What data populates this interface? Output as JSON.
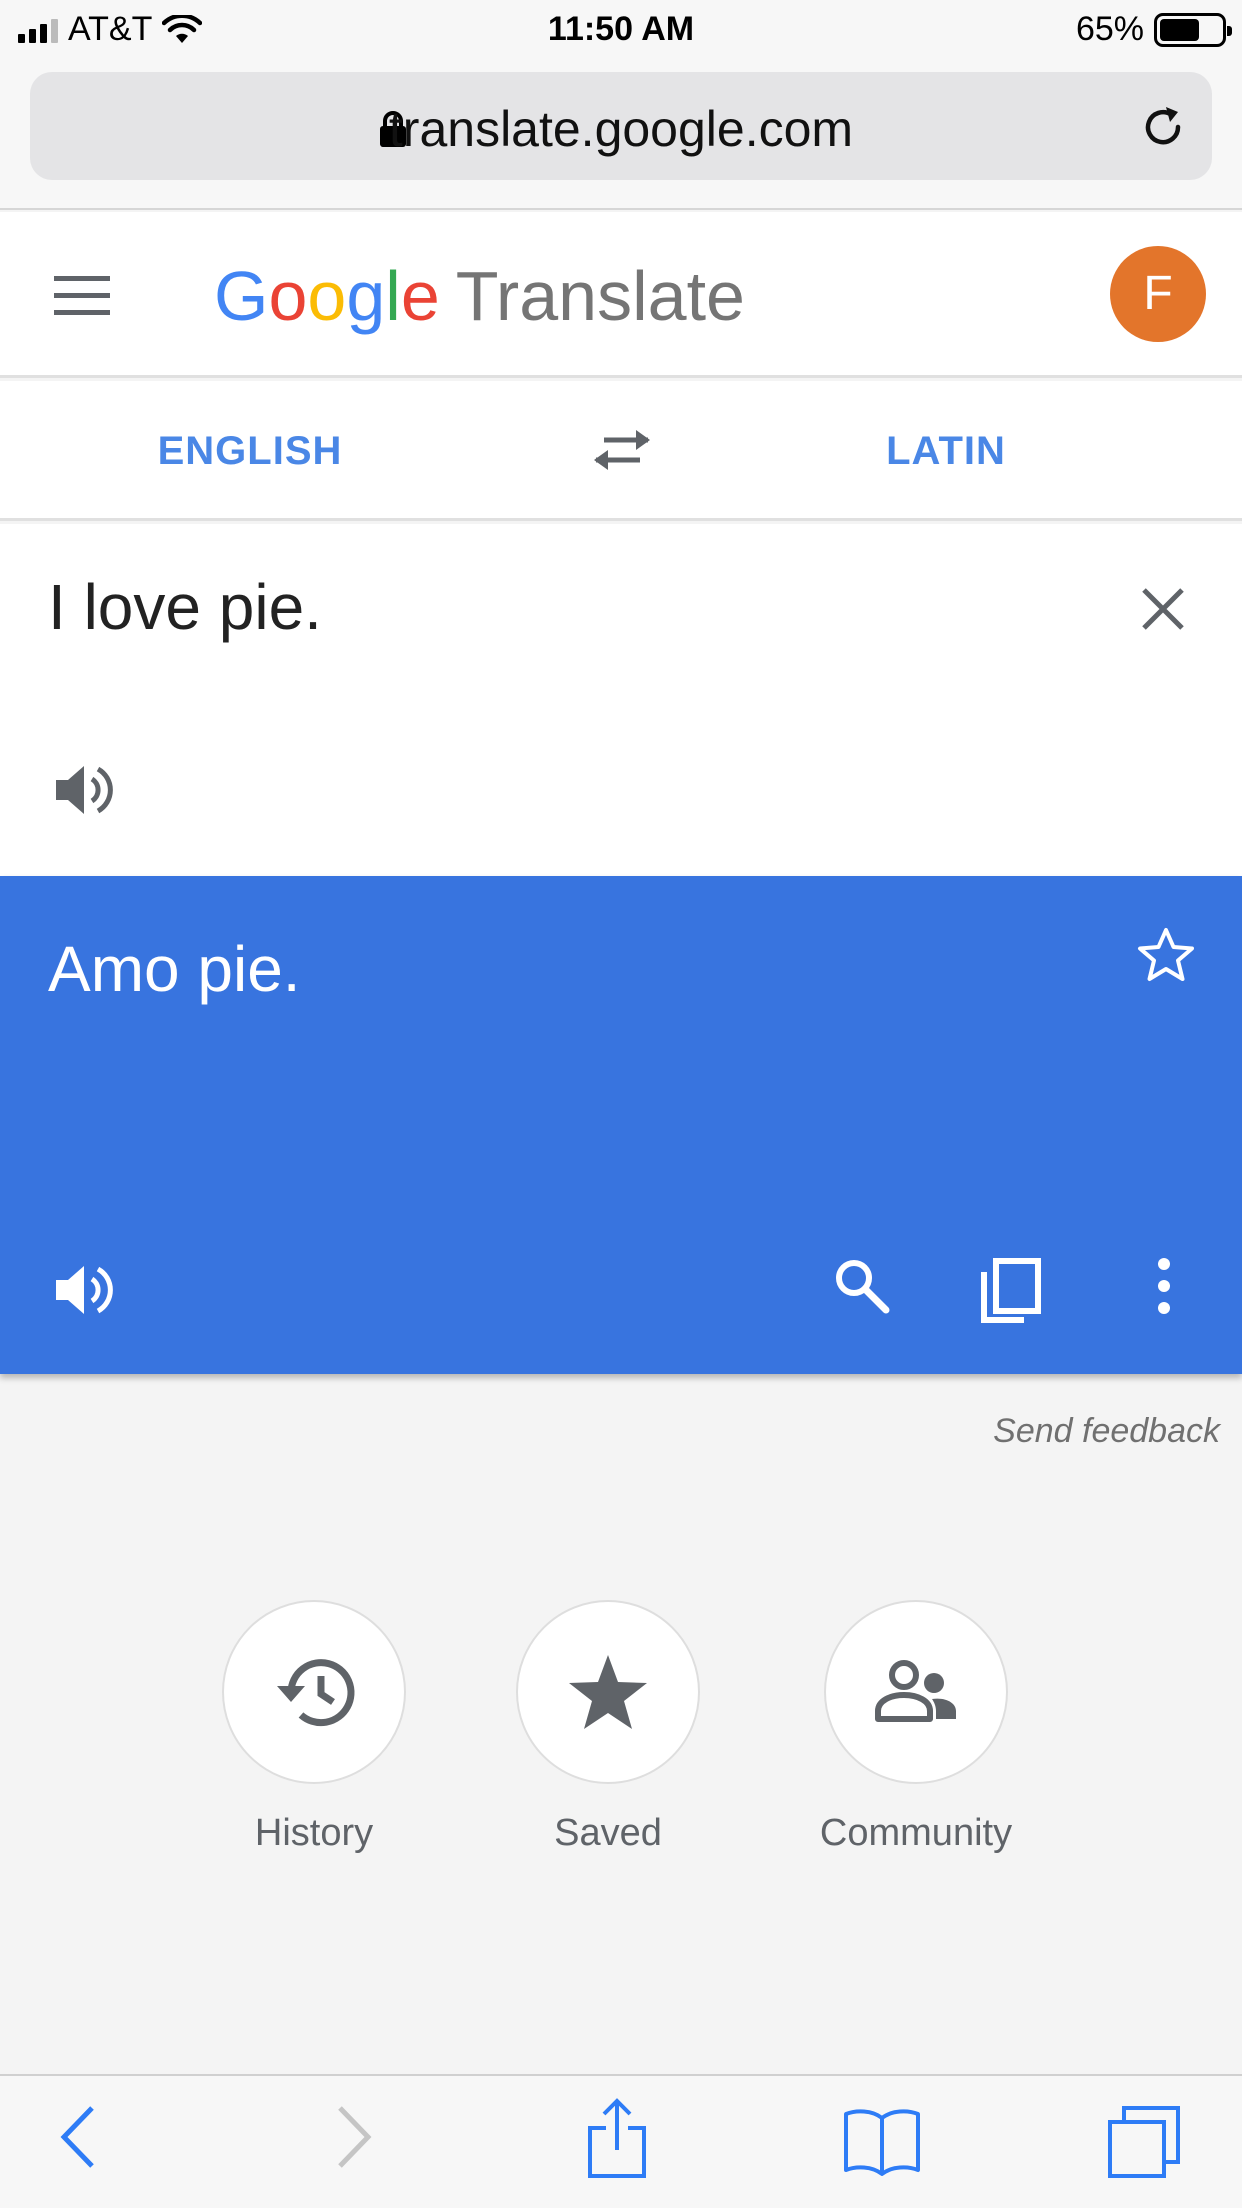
{
  "status_bar": {
    "carrier": "AT&T",
    "time": "11:50 AM",
    "battery_percent": "65%",
    "battery_level": 0.65
  },
  "browser": {
    "url": "translate.google.com"
  },
  "header": {
    "logo_letters": [
      "G",
      "o",
      "o",
      "g",
      "l",
      "e"
    ],
    "app_name": "Translate",
    "avatar_initial": "F"
  },
  "languages": {
    "source": "ENGLISH",
    "target": "LATIN"
  },
  "source": {
    "text": "I love pie."
  },
  "result": {
    "text": "Amo pie."
  },
  "feedback_link": "Send feedback",
  "shortcuts": [
    {
      "label": "History",
      "icon": "history-icon"
    },
    {
      "label": "Saved",
      "icon": "star-icon"
    },
    {
      "label": "Community",
      "icon": "community-icon"
    }
  ],
  "colors": {
    "accent_blue": "#3874df",
    "lang_blue": "#4a87e6",
    "avatar_orange": "#e3752b",
    "ios_blue": "#2e7cf6"
  }
}
